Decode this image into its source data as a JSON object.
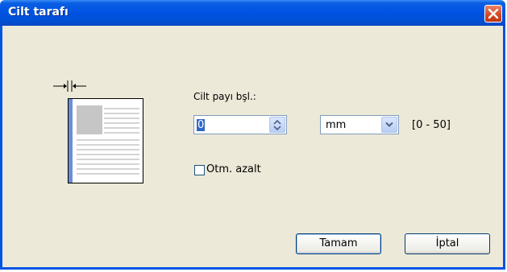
{
  "window": {
    "title": "Cilt tarafı"
  },
  "gutter": {
    "label": "Cilt payı bşl.:",
    "value": "0",
    "unit": "mm",
    "range": "[0 - 50]"
  },
  "auto_reduce": {
    "label": "Otm. azalt",
    "checked": false
  },
  "buttons": {
    "ok": "Tamam",
    "cancel": "İptal"
  },
  "icons": {
    "close": "close-icon",
    "spin": "spin-arrows-icon",
    "dropdown": "chevron-down-icon",
    "diagram": "binding-margin-diagram-icon"
  },
  "colors": {
    "titlebar": "#0054e3",
    "dialog": "#ece9d8",
    "close": "#d3461f"
  }
}
